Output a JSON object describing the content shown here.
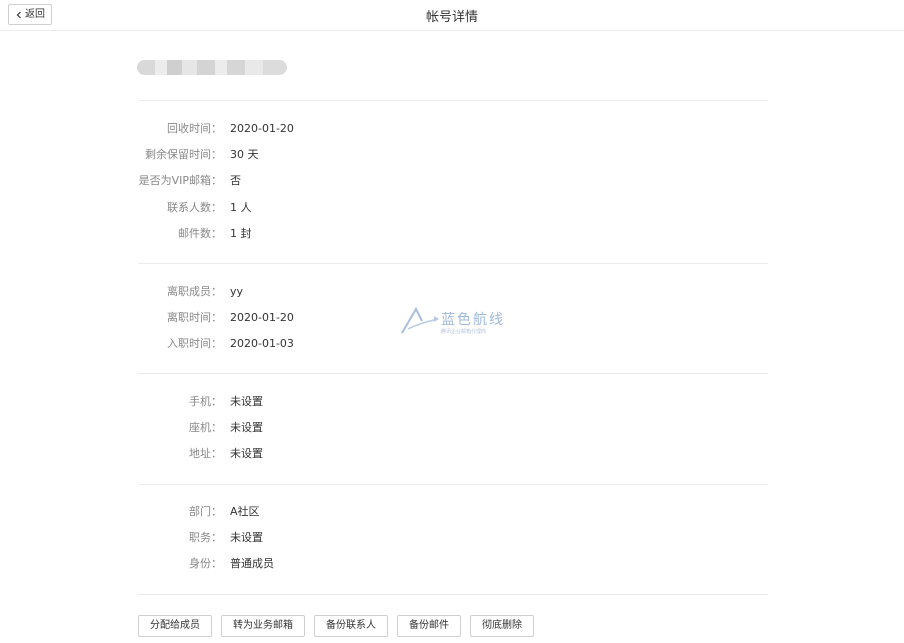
{
  "header": {
    "back_label": "返回",
    "title": "帐号详情"
  },
  "sections": {
    "recycle": [
      {
        "label": "回收时间：",
        "value": "2020-01-20"
      },
      {
        "label": "剩余保留时间：",
        "value": "30 天"
      },
      {
        "label": "是否为VIP邮箱：",
        "value": "否"
      },
      {
        "label": "联系人数：",
        "value": "1 人"
      },
      {
        "label": "邮件数：",
        "value": "1 封"
      }
    ],
    "employment": [
      {
        "label": "离职成员：",
        "value": "yy"
      },
      {
        "label": "离职时间：",
        "value": "2020-01-20"
      },
      {
        "label": "入职时间：",
        "value": "2020-01-03"
      }
    ],
    "contact": [
      {
        "label": "手机：",
        "value": "未设置"
      },
      {
        "label": "座机：",
        "value": "未设置"
      },
      {
        "label": "地址：",
        "value": "未设置"
      }
    ],
    "org": [
      {
        "label": "部门：",
        "value": "A社区"
      },
      {
        "label": "职务：",
        "value": "未设置"
      },
      {
        "label": "身份：",
        "value": "普通成员"
      }
    ]
  },
  "watermark": {
    "title": "蓝色航线",
    "subtitle": "腾讯企业邮箱代理商",
    "color": "#9fb8dd"
  },
  "actions": {
    "assign": "分配给成员",
    "to_business": "转为业务邮箱",
    "backup_contacts": "备份联系人",
    "backup_mail": "备份邮件",
    "delete": "彻底删除"
  }
}
